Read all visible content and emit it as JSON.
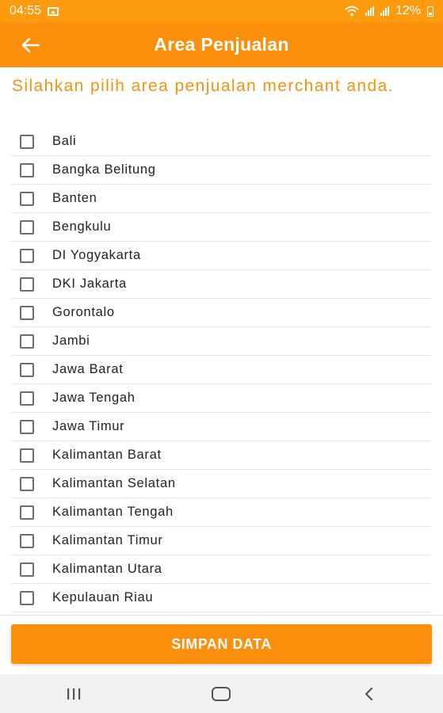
{
  "status_bar": {
    "time": "04:55",
    "battery": "12%",
    "icons": [
      "image-icon",
      "wifi-icon",
      "signal-icon",
      "signal-icon",
      "battery-icon"
    ]
  },
  "header": {
    "title": "Area Penjualan",
    "back_icon": "arrow-left-icon",
    "background": "#fc8f0c"
  },
  "instruction": "Silahkan pilih area penjualan merchant anda.",
  "areas": [
    {
      "label": "Bali",
      "checked": false
    },
    {
      "label": "Bangka Belitung",
      "checked": false
    },
    {
      "label": "Banten",
      "checked": false
    },
    {
      "label": "Bengkulu",
      "checked": false
    },
    {
      "label": "DI Yogyakarta",
      "checked": false
    },
    {
      "label": "DKI Jakarta",
      "checked": false
    },
    {
      "label": "Gorontalo",
      "checked": false
    },
    {
      "label": "Jambi",
      "checked": false
    },
    {
      "label": "Jawa Barat",
      "checked": false
    },
    {
      "label": "Jawa Tengah",
      "checked": false
    },
    {
      "label": "Jawa Timur",
      "checked": false
    },
    {
      "label": "Kalimantan Barat",
      "checked": false
    },
    {
      "label": "Kalimantan Selatan",
      "checked": false
    },
    {
      "label": "Kalimantan Tengah",
      "checked": false
    },
    {
      "label": "Kalimantan Timur",
      "checked": false
    },
    {
      "label": "Kalimantan Utara",
      "checked": false
    },
    {
      "label": "Kepulauan Riau",
      "checked": false
    }
  ],
  "save_button": {
    "label": "SIMPAN DATA"
  },
  "nav_bar": {
    "icons": [
      "recent-apps-icon",
      "home-icon",
      "back-icon"
    ]
  },
  "colors": {
    "accent": "#fc8f0c",
    "instruction_text": "#f29311"
  }
}
